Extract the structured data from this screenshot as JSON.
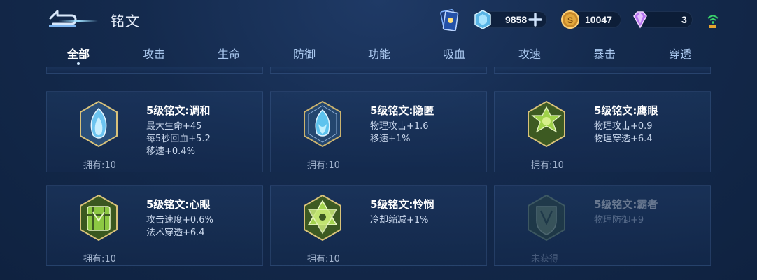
{
  "header": {
    "title": "铭文",
    "resources": {
      "gems": "9858",
      "gold": "10047",
      "diamonds": "3"
    }
  },
  "tabs": [
    {
      "label": "全部",
      "active": true
    },
    {
      "label": "攻击",
      "active": false
    },
    {
      "label": "生命",
      "active": false
    },
    {
      "label": "防御",
      "active": false
    },
    {
      "label": "功能",
      "active": false
    },
    {
      "label": "吸血",
      "active": false
    },
    {
      "label": "攻速",
      "active": false
    },
    {
      "label": "暴击",
      "active": false
    },
    {
      "label": "穿透",
      "active": false
    }
  ],
  "cards": [
    {
      "name": "5级铭文:调和",
      "stats": [
        "最大生命+45",
        "每5秒回血+5.2",
        "移速+0.4%"
      ],
      "owned": "拥有:10",
      "icon": "blue-flame-icon"
    },
    {
      "name": "5级铭文:隐匿",
      "stats": [
        "物理攻击+1.6",
        "移速+1%"
      ],
      "owned": "拥有:10",
      "icon": "blue-flame-hex-icon"
    },
    {
      "name": "5级铭文:鹰眼",
      "stats": [
        "物理攻击+0.9",
        "物理穿透+6.4"
      ],
      "owned": "拥有:10",
      "icon": "green-clover-icon"
    },
    {
      "name": "5级铭文:心眼",
      "stats": [
        "攻击速度+0.6%",
        "法术穿透+6.4"
      ],
      "owned": "拥有:10",
      "icon": "green-gate-icon"
    },
    {
      "name": "5级铭文:怜悯",
      "stats": [
        "冷却缩减+1%"
      ],
      "owned": "拥有:10",
      "icon": "green-star-icon"
    },
    {
      "name": "5级铭文:霸者",
      "stats": [
        "物理防御+9"
      ],
      "owned": "未获得",
      "icon": "green-shield-icon"
    }
  ],
  "colors": {
    "background": "#142a4d",
    "active_tab": "#ffffff",
    "tab": "#a9c7ee",
    "stat_text": "#c9d7ec"
  }
}
